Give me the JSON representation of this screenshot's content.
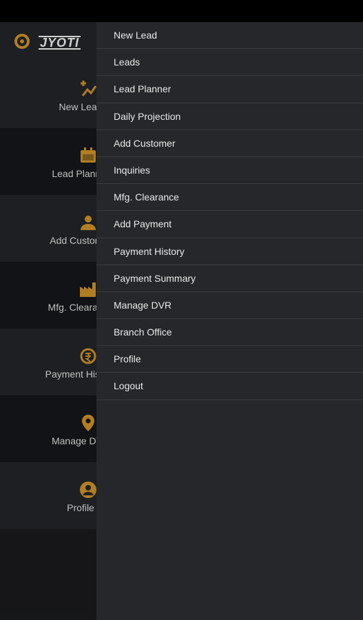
{
  "brand": {
    "logo_text": "JYOTI"
  },
  "tiles": [
    {
      "label": "New Lead",
      "icon": "add-chart-icon"
    },
    {
      "label": "Lead Planner",
      "icon": "calendar-icon"
    },
    {
      "label": "Add Customer",
      "icon": "person-icon"
    },
    {
      "label": "Mfg. Clearance",
      "icon": "factory-icon"
    },
    {
      "label": "Payment History",
      "icon": "payment-icon"
    },
    {
      "label": "Manage DVR",
      "icon": "location-pin-icon"
    },
    {
      "label": "Profile",
      "icon": "account-circle-icon"
    }
  ],
  "menu": [
    "New Lead",
    "Leads",
    "Lead Planner",
    "Daily Projection",
    "Add Customer",
    "Inquiries",
    "Mfg. Clearance",
    "Add Payment",
    "Payment History",
    "Payment Summary",
    "Manage DVR",
    "Branch Office",
    "Profile",
    "Logout"
  ],
  "colors": {
    "accent": "#d89a2b",
    "drawer": "#25272b",
    "background": "#1b1c1f"
  }
}
